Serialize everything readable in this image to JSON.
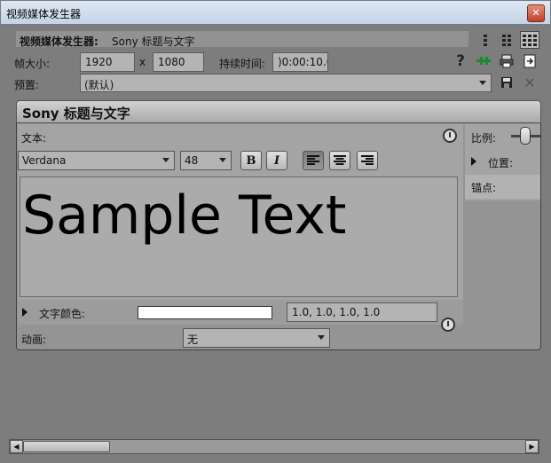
{
  "window": {
    "title": "视频媒体发生器",
    "close_label": "✕"
  },
  "plugin": {
    "label": "视频媒体发生器:",
    "value": "Sony 标题与文字"
  },
  "frame_size": {
    "label": "帧大小:",
    "width": "1920",
    "separator": "x",
    "height": "1080"
  },
  "duration": {
    "label": "持续时间:",
    "value": ")0:00:10.0("
  },
  "preset": {
    "label": "预置:",
    "value": "(默认)"
  },
  "section": {
    "title": "Sony 标题与文字"
  },
  "text_panel": {
    "label": "文本:",
    "font": "Verdana",
    "size": "48",
    "bold_label": "B",
    "italic_label": "I",
    "sample_text": "Sample Text"
  },
  "text_color": {
    "label": "文字颜色:",
    "value": "1.0, 1.0, 1.0, 1.0",
    "swatch": "#ffffff"
  },
  "animation": {
    "label": "动画:",
    "value": "无"
  },
  "right_panel": {
    "scale_label": "比例:",
    "position_label": "位置:",
    "anchor_label": "锚点:"
  },
  "toolbar_help": "?",
  "colors": {
    "accent_green": "#1a8a2a",
    "panel_bg": "#a4a4a4"
  }
}
